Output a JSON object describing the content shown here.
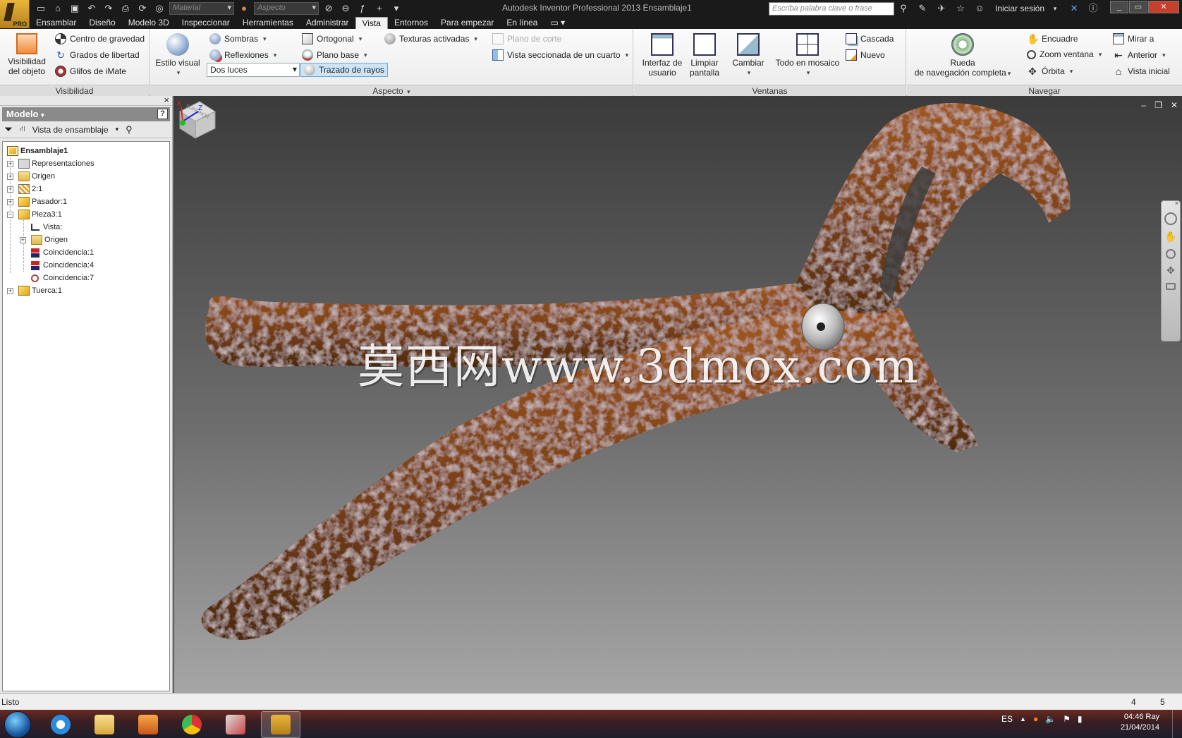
{
  "titlebar": {
    "title": "Autodesk Inventor Professional 2013    Ensamblaje1",
    "material_placeholder": "Material",
    "appearance_placeholder": "Aspecto",
    "search_placeholder": "Escriba palabra clave o frase",
    "login_label": "Iniciar sesión",
    "logo_badge": "PRO"
  },
  "tabs": [
    "Ensamblar",
    "Diseño",
    "Modelo 3D",
    "Inspeccionar",
    "Herramientas",
    "Administrar",
    "Vista",
    "Entornos",
    "Para empezar",
    "En línea"
  ],
  "active_tab": "Vista",
  "ribbon": {
    "visibilidad": {
      "title": "Visibilidad",
      "object_visibility_line1": "Visibilidad",
      "object_visibility_line2": "del objeto",
      "centro_gravedad": "Centro de gravedad",
      "grados_libertad": "Grados de libertad",
      "glifos_imate": "Glifos de iMate"
    },
    "aspecto": {
      "title": "Aspecto",
      "estilo_visual": "Estilo visual",
      "sombras": "Sombras",
      "reflexiones": "Reflexiones",
      "lighting_value": "Dos luces",
      "ortogonal": "Ortogonal",
      "plano_base": "Plano base",
      "trazado_rayos": "Trazado de rayos",
      "texturas": "Texturas activadas",
      "plano_corte": "Plano de corte",
      "vista_seccionada": "Vista seccionada de un cuarto"
    },
    "ventanas": {
      "title": "Ventanas",
      "interfaz_line1": "Interfaz de",
      "interfaz_line2": "usuario",
      "limpiar_line1": "Limpiar",
      "limpiar_line2": "pantalla",
      "cambiar": "Cambiar",
      "mosaico": "Todo en mosaico",
      "cascada": "Cascada",
      "nuevo": "Nuevo"
    },
    "navegar": {
      "title": "Navegar",
      "rueda_line1": "Rueda",
      "rueda_line2": "de navegación completa",
      "encuadre": "Encuadre",
      "zoom_ventana": "Zoom ventana",
      "orbita": "Órbita",
      "mirar_a": "Mirar a",
      "anterior": "Anterior",
      "vista_inicial": "Vista inicial"
    }
  },
  "browser": {
    "header": "Modelo",
    "help": "?",
    "view_selector": "Vista de ensamblaje",
    "tree": [
      {
        "label": "Ensamblaje1",
        "level": 0,
        "icon": "assembly",
        "bold": true,
        "expander": ""
      },
      {
        "label": "Representaciones",
        "level": 1,
        "icon": "representations",
        "expander": "+"
      },
      {
        "label": "Origen",
        "level": 1,
        "icon": "folder",
        "expander": "+"
      },
      {
        "label": "2:1",
        "level": 1,
        "icon": "pattern",
        "expander": "+"
      },
      {
        "label": "Pasador:1",
        "level": 1,
        "icon": "part",
        "expander": "+"
      },
      {
        "label": "Pieza3:1",
        "level": 1,
        "icon": "part",
        "expander": "−"
      },
      {
        "label": "Vista:",
        "level": 2,
        "icon": "view",
        "expander": ""
      },
      {
        "label": "Origen",
        "level": 2,
        "icon": "folder",
        "expander": "+"
      },
      {
        "label": "Coincidencia:1",
        "level": 2,
        "icon": "constraint",
        "expander": ""
      },
      {
        "label": "Coincidencia:4",
        "level": 2,
        "icon": "constraint",
        "expander": ""
      },
      {
        "label": "Coincidencia:7",
        "level": 2,
        "icon": "constraint-alt",
        "expander": ""
      },
      {
        "label": "Tuerca:1",
        "level": 1,
        "icon": "part",
        "expander": "+"
      }
    ]
  },
  "viewport": {
    "watermark": "莫西网www.3dmox.com",
    "viewcube_face": "SUPERIOR",
    "triad_labels": {
      "x": "X",
      "z": "Z"
    }
  },
  "statusbar": {
    "status": "Listo",
    "count1": "4",
    "count2": "5"
  },
  "taskbar": {
    "language": "ES",
    "time": "04:46 Ray",
    "date": "21/04/2014"
  },
  "colors": {
    "rust": "#8a4a1a",
    "viewport_top": "#3b3b3b",
    "viewport_bottom": "#a6a6a6",
    "ribbon_highlight": "#cde4f7"
  }
}
